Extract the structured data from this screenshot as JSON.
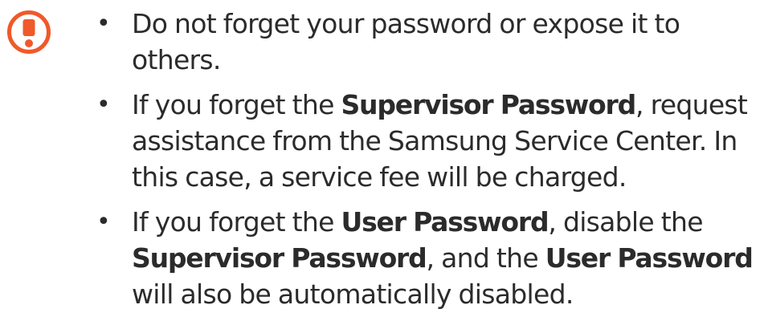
{
  "icon": {
    "name": "caution-icon",
    "color": "#f0592a"
  },
  "notes": [
    {
      "bullet": "•",
      "segments": [
        {
          "text": "Do not forget your password or expose it to others.",
          "bold": false
        }
      ]
    },
    {
      "bullet": "•",
      "segments": [
        {
          "text": "If you forget the ",
          "bold": false
        },
        {
          "text": "Supervisor Password",
          "bold": true
        },
        {
          "text": ", request assistance from the Samsung Service Center. In this case, a service fee will be charged.",
          "bold": false
        }
      ]
    },
    {
      "bullet": "•",
      "segments": [
        {
          "text": "If you forget the ",
          "bold": false
        },
        {
          "text": "User Password",
          "bold": true
        },
        {
          "text": ", disable the ",
          "bold": false
        },
        {
          "text": "Supervisor Password",
          "bold": true
        },
        {
          "text": ", and the ",
          "bold": false
        },
        {
          "text": "User Password",
          "bold": true
        },
        {
          "text": " will also be automatically disabled.",
          "bold": false
        }
      ]
    }
  ]
}
